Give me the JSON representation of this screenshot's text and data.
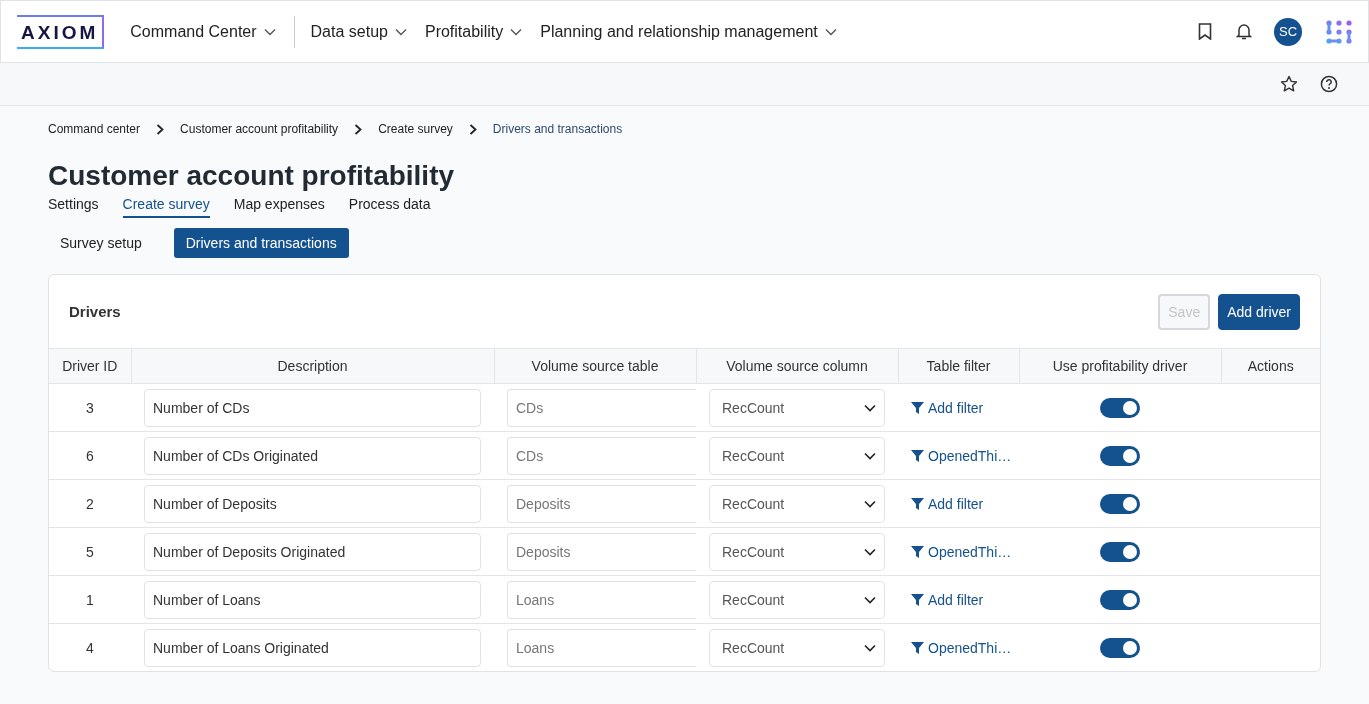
{
  "header": {
    "logo": "AXIOM",
    "home_menu": "Command Center",
    "nav": [
      "Data setup",
      "Profitability",
      "Planning and relationship management"
    ],
    "avatar": "SC"
  },
  "breadcrumbs": [
    "Command center",
    "Customer account profitability",
    "Create survey",
    "Drivers and transactions"
  ],
  "title": "Customer account profitability",
  "tabs": [
    {
      "label": "Settings",
      "selected": false
    },
    {
      "label": "Create survey",
      "selected": true
    },
    {
      "label": "Map expenses",
      "selected": false
    },
    {
      "label": "Process data",
      "selected": false
    }
  ],
  "subtabs": [
    {
      "label": "Survey setup",
      "selected": false
    },
    {
      "label": "Drivers and transactions",
      "selected": true
    }
  ],
  "card": {
    "title": "Drivers",
    "buttons": [
      {
        "label": "Save",
        "disabled": true
      },
      {
        "label": "Add driver",
        "disabled": false
      }
    ]
  },
  "table": {
    "columns": [
      "Driver ID",
      "Description",
      "Volume source table",
      "Volume source column",
      "Table filter",
      "Use profitability driver",
      "Actions"
    ],
    "rows": [
      {
        "id": "3",
        "description": "Number of CDs",
        "source_table": "CDs",
        "source_column": "RecCount",
        "filter": "Add filter",
        "on": true
      },
      {
        "id": "6",
        "description": "Number of CDs Originated",
        "source_table": "CDs",
        "source_column": "RecCount",
        "filter": "OpenedThi…",
        "on": true
      },
      {
        "id": "2",
        "description": "Number of Deposits",
        "source_table": "Deposits",
        "source_column": "RecCount",
        "filter": "Add filter",
        "on": true
      },
      {
        "id": "5",
        "description": "Number of Deposits Originated",
        "source_table": "Deposits",
        "source_column": "RecCount",
        "filter": "OpenedThi…",
        "on": true
      },
      {
        "id": "1",
        "description": "Number of Loans",
        "source_table": "Loans",
        "source_column": "RecCount",
        "filter": "Add filter",
        "on": true
      },
      {
        "id": "4",
        "description": "Number of Loans Originated",
        "source_table": "Loans",
        "source_column": "RecCount",
        "filter": "OpenedThi…",
        "on": true
      }
    ]
  }
}
